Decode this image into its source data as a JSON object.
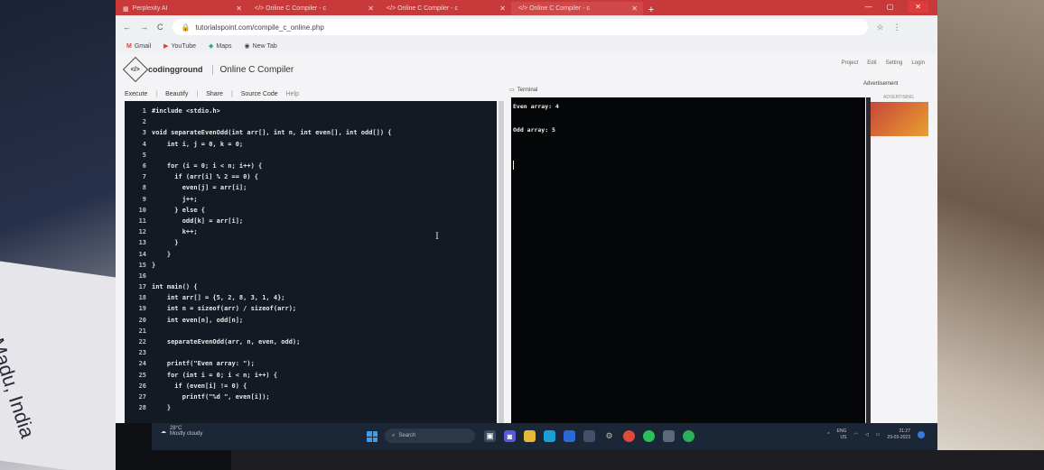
{
  "background": {
    "paper_text": "nMadu, India"
  },
  "browser": {
    "tabs": [
      {
        "icon": "perplexity-icon",
        "label": "Perplexity AI",
        "active": false
      },
      {
        "icon": "code-icon",
        "label": "</> Online C Compiler - c",
        "active": false
      },
      {
        "icon": "code-icon",
        "label": "</> Online C Compiler - c",
        "active": false
      },
      {
        "icon": "code-icon",
        "label": "</> Online C Compiler - c",
        "active": true
      }
    ],
    "new_tab": "+",
    "url": "tutorialspoint.com/compile_c_online.php",
    "bookmarks": [
      {
        "icon": "gmail-icon",
        "label": "Gmail"
      },
      {
        "icon": "youtube-icon",
        "label": "YouTube"
      },
      {
        "icon": "maps-icon",
        "label": "Maps"
      },
      {
        "icon": "globe-icon",
        "label": "New Tab"
      }
    ]
  },
  "site": {
    "logo": "codingground",
    "title": "Online C Compiler",
    "menu": [
      "Project",
      "Edit",
      "Setting",
      "Login"
    ],
    "toolbar": {
      "execute": "Execute",
      "beautify": "Beautify",
      "share": "Share",
      "source_code": "Source Code",
      "help": "Help"
    },
    "terminal_label": "Terminal",
    "advertisement": "Advertisement",
    "advertising": "ADVERTISING"
  },
  "code_lines": [
    {
      "n": "1",
      "text": "#include <stdio.h>"
    },
    {
      "n": "2",
      "text": ""
    },
    {
      "n": "3",
      "text": "void separateEvenOdd(int arr[], int n, int even[], int odd[]) {"
    },
    {
      "n": "4",
      "text": "    int i, j = 0, k = 0;"
    },
    {
      "n": "5",
      "text": ""
    },
    {
      "n": "6",
      "text": "    for (i = 0; i < n; i++) {"
    },
    {
      "n": "7",
      "text": "      if (arr[i] % 2 == 0) {"
    },
    {
      "n": "8",
      "text": "        even[j] = arr[i];"
    },
    {
      "n": "9",
      "text": "        j++;"
    },
    {
      "n": "10",
      "text": "      } else {"
    },
    {
      "n": "11",
      "text": "        odd[k] = arr[i];"
    },
    {
      "n": "12",
      "text": "        k++;"
    },
    {
      "n": "13",
      "text": "      }"
    },
    {
      "n": "14",
      "text": "    }"
    },
    {
      "n": "15",
      "text": "}"
    },
    {
      "n": "16",
      "text": ""
    },
    {
      "n": "17",
      "text": "int main() {"
    },
    {
      "n": "18",
      "text": "    int arr[] = {5, 2, 8, 3, 1, 4};"
    },
    {
      "n": "19",
      "text": "    int n = sizeof(arr) / sizeof(arr);"
    },
    {
      "n": "20",
      "text": "    int even[n], odd[n];"
    },
    {
      "n": "21",
      "text": ""
    },
    {
      "n": "22",
      "text": "    separateEvenOdd(arr, n, even, odd);"
    },
    {
      "n": "23",
      "text": ""
    },
    {
      "n": "24",
      "text": "    printf(\"Even array: \");"
    },
    {
      "n": "25",
      "text": "    for (int i = 0; i < n; i++) {"
    },
    {
      "n": "26",
      "text": "      if (even[i] != 0) {"
    },
    {
      "n": "27",
      "text": "        printf(\"%d \", even[i]);"
    },
    {
      "n": "28",
      "text": "    }"
    }
  ],
  "terminal": {
    "line1": "Even array: 4",
    "line2": "Odd array: 5"
  },
  "taskbar": {
    "temperature": "28°C",
    "weather": "Mostly cloudy",
    "search": "Search",
    "lang": "ENG",
    "region": "US",
    "time": "21:27",
    "date": "29-03-2023"
  }
}
